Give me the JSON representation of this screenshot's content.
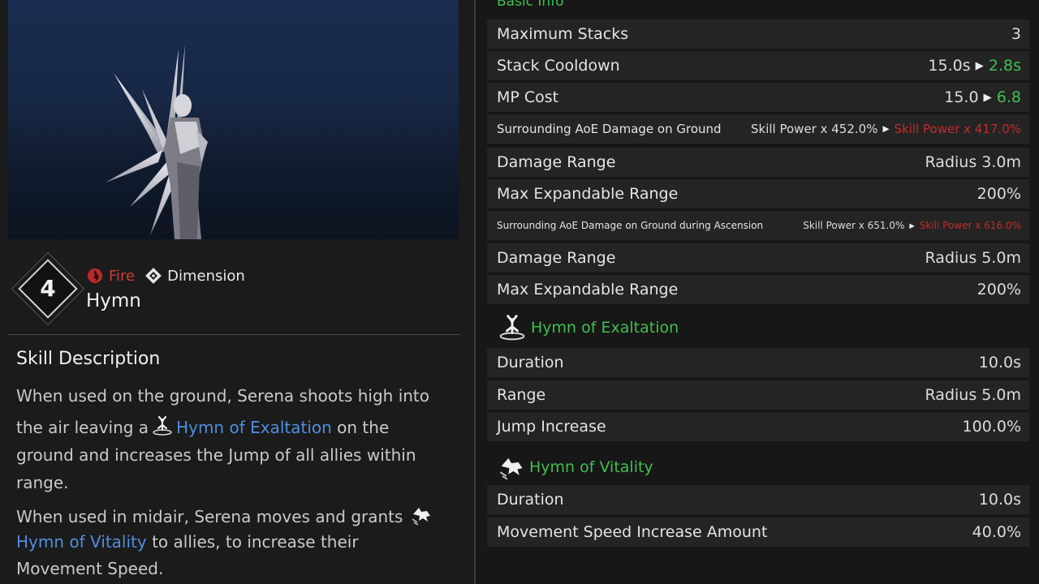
{
  "skill": {
    "slot": "4",
    "element": "Fire",
    "type": "Dimension",
    "name": "Hymn",
    "icons": {
      "element": "fire-icon",
      "type": "dimension-icon"
    }
  },
  "description": {
    "title": "Skill Description",
    "p1_line1": "When used on the ground, Serena shoots high into",
    "p1_line2_pre": "the air leaving a",
    "p1_line2_link": "Hymn of Exaltation",
    "p1_line2_post": "on the",
    "p1_line3": "ground and increases the Jump of all allies within",
    "p1_line4": "range.",
    "p2_line1": "When used in midair, Serena moves and grants",
    "p2_line2_link": "Hymn of Vitality",
    "p2_line2_post": "to allies, to increase their",
    "p2_line3": "Movement Speed."
  },
  "stats": {
    "section_title": "Basic Info",
    "max_stacks": {
      "label": "Maximum Stacks",
      "value": "3"
    },
    "stack_cooldown": {
      "label": "Stack Cooldown",
      "old": "15.0s",
      "new": "2.8s"
    },
    "mp_cost": {
      "label": "MP Cost",
      "old": "15.0",
      "new": "6.8"
    },
    "aoe_ground": {
      "label": "Surrounding AoE Damage on Ground",
      "old": "Skill Power x 452.0%",
      "new": "Skill Power x 417.0%"
    },
    "damage_range_1": {
      "label": "Damage Range",
      "value": "Radius 3.0m"
    },
    "max_exp_range_1": {
      "label": "Max Expandable Range",
      "value": "200%"
    },
    "aoe_ascension": {
      "label": "Surrounding AoE Damage on Ground during Ascension",
      "old": "Skill Power x 651.0%",
      "new": "Skill Power x 616.0%"
    },
    "damage_range_2": {
      "label": "Damage Range",
      "value": "Radius 5.0m"
    },
    "max_exp_range_2": {
      "label": "Max Expandable Range",
      "value": "200%"
    },
    "exaltation": {
      "title": "Hymn of Exaltation",
      "duration": {
        "label": "Duration",
        "value": "10.0s"
      },
      "range": {
        "label": "Range",
        "value": "Radius 5.0m"
      },
      "jump": {
        "label": "Jump Increase",
        "value": "100.0%"
      }
    },
    "vitality": {
      "title": "Hymn of Vitality",
      "duration": {
        "label": "Duration",
        "value": "10.0s"
      },
      "speed": {
        "label": "Movement Speed Increase Amount",
        "value": "40.0%"
      }
    }
  },
  "colors": {
    "increase": "#3fbf4f",
    "decrease": "#c42a2a",
    "link": "#4f8fde",
    "element_fire": "#d23a3a"
  }
}
